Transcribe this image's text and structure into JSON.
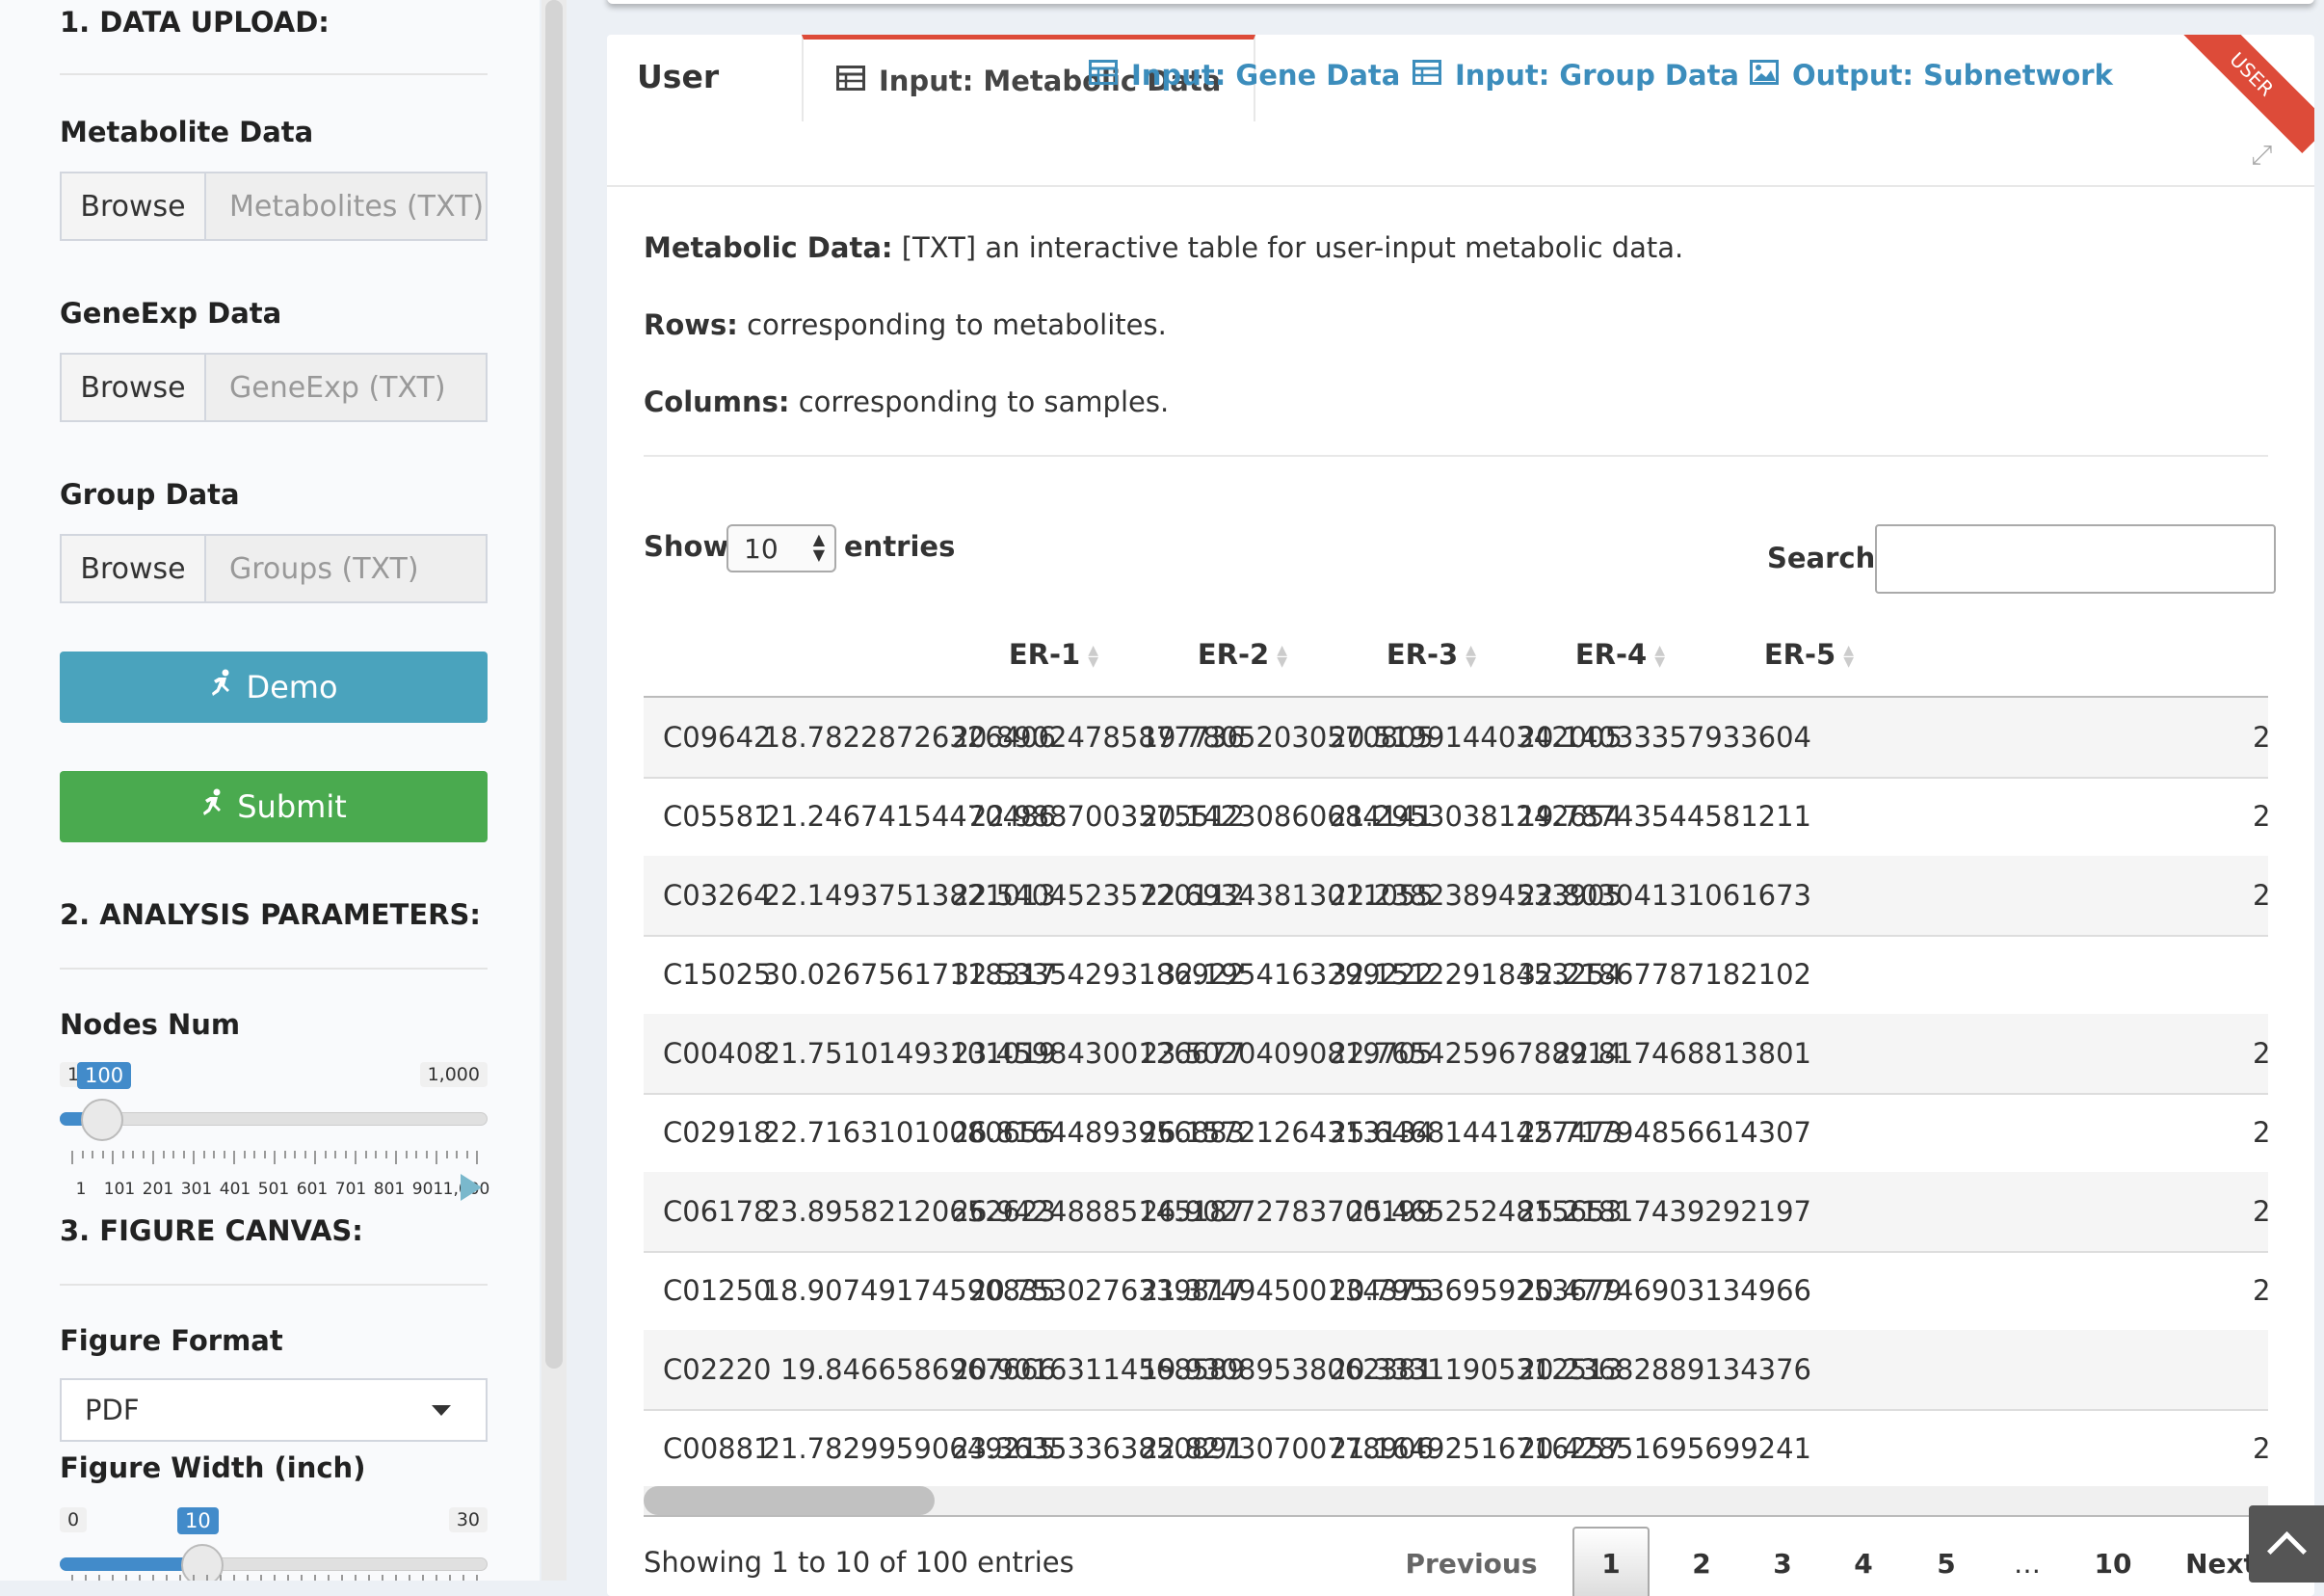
{
  "sidebar": {
    "sections": {
      "upload": "1. DATA UPLOAD:",
      "params": "2. ANALYSIS PARAMETERS:",
      "canvas": "3. FIGURE CANVAS:"
    },
    "metabolite": {
      "label": "Metabolite Data",
      "browse": "Browse",
      "placeholder": "Metabolites (TXT)"
    },
    "geneexp": {
      "label": "GeneExp Data",
      "browse": "Browse",
      "placeholder": "GeneExp (TXT)"
    },
    "group": {
      "label": "Group Data",
      "browse": "Browse",
      "placeholder": "Groups (TXT)"
    },
    "demo_label": "Demo",
    "submit_label": "Submit",
    "nodes": {
      "label": "Nodes Num",
      "min": "1",
      "max": "1,000",
      "value": "100",
      "fraction": 0.1,
      "tick_labels": [
        "1",
        "101",
        "201",
        "301",
        "401",
        "501",
        "601",
        "701",
        "801",
        "901",
        "1,000"
      ]
    },
    "format": {
      "label": "Figure Format",
      "value": "PDF"
    },
    "width": {
      "label": "Figure Width (inch)",
      "min": "0",
      "max": "30",
      "value": "10",
      "fraction": 0.333
    }
  },
  "tabs": {
    "box_title": "User",
    "items": [
      {
        "label": "Input: Metabolic Data",
        "icon": "table-icon",
        "active": true
      },
      {
        "label": "Input: Gene Data",
        "icon": "table-icon",
        "active": false
      },
      {
        "label": "Input: Group Data",
        "icon": "table-icon",
        "active": false
      },
      {
        "label": "Output: Subnetwork",
        "icon": "image-icon",
        "active": false
      }
    ],
    "ribbon": "USER"
  },
  "description": {
    "line1_bold": "Metabolic Data:",
    "line1": " [TXT] an interactive table for user-input metabolic data.",
    "line2_bold": "Rows:",
    "line2": " corresponding to metabolites.",
    "line3_bold": "Columns:",
    "line3": " corresponding to samples."
  },
  "table_controls": {
    "show": "Show",
    "length": "10",
    "entries": "entries",
    "search": "Search:"
  },
  "table": {
    "columns": [
      "",
      "ER-1",
      "ER-2",
      "ER-3",
      "ER-4",
      "ER-5"
    ],
    "rows": [
      [
        "C09642",
        "18.78228726326406",
        "20.89024785877736",
        "19.78052030570805",
        "20.51991440342005",
        "20.14033357933604",
        "2"
      ],
      [
        "C05581",
        "21.24674154470486",
        "22.9887003575512",
        "20.14230860684141",
        "21.29530381242654",
        "19.78743544581211",
        "2"
      ],
      [
        "C03264",
        "22.14937513821013",
        "22.54045235720112",
        "22.69343813011055",
        "22.23823894533905",
        "22.80304131061673",
        "2"
      ],
      [
        "C15025",
        "30.02675617118317",
        "32.53354293186922",
        "32.1954163299222",
        "32.15122918453254",
        "32.21867787182102",
        ""
      ],
      [
        "C00408",
        "21.75101493101019",
        "23.45984300126677",
        "23.50204090819705",
        "22.76542596788914",
        "22.817468813801",
        "2"
      ],
      [
        "C02918",
        "22.71631010080655",
        "26.81644893956883",
        "26.15721264313134",
        "25.64681441427473",
        "25.71794856614307",
        "2"
      ],
      [
        "C06178",
        "23.89582120652623",
        "26.94248885145187",
        "26.90272783700199",
        "25.4652524815653",
        "25.21817439292197",
        "2"
      ],
      [
        "C01250",
        "18.90749174590835",
        "20.7530276339817",
        "21.37494500134375",
        "20.79536959253679",
        "20.47746903134966",
        "2"
      ],
      [
        "C02220",
        "19.8466586967666",
        "20.90163114568589",
        "19.93089538062381",
        "20.33311905312513",
        "20.23682889134376",
        ""
      ],
      [
        "C00881",
        "21.78299590649215",
        "23.36353363850891",
        "22.82730700778906",
        "21.16492516716257",
        "20.42851695699241",
        "2"
      ]
    ]
  },
  "pagination": {
    "info": "Showing 1 to 10 of 100 entries",
    "previous": "Previous",
    "pages": [
      "1",
      "2",
      "3",
      "4",
      "5",
      "…",
      "10"
    ],
    "next": "Next"
  }
}
